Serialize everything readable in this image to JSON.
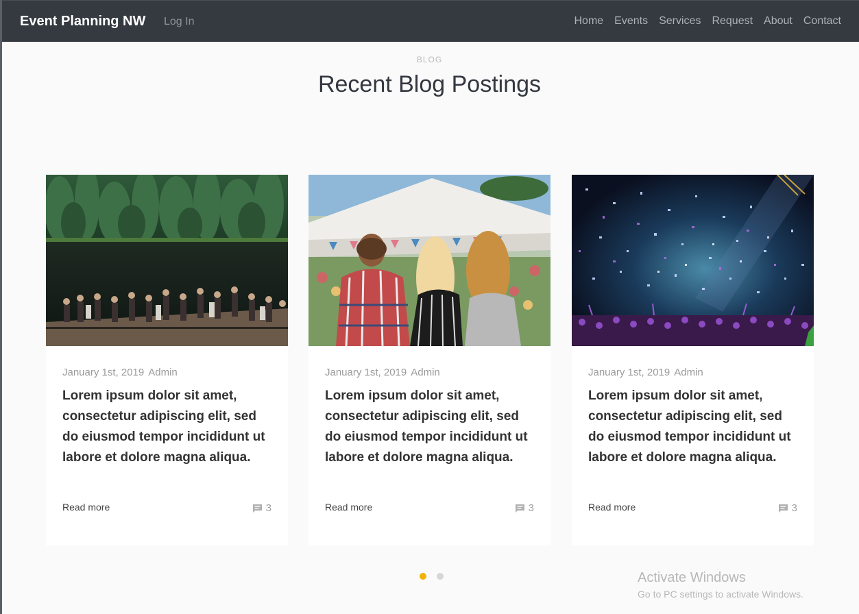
{
  "navbar": {
    "brand": "Event Planning NW",
    "login": "Log In",
    "links": [
      "Home",
      "Events",
      "Services",
      "Request",
      "About",
      "Contact"
    ]
  },
  "section": {
    "eyebrow": "BLOG",
    "title": "Recent Blog Postings"
  },
  "posts": [
    {
      "image": "lakeside-party-photo",
      "date": "January 1st, 2019",
      "author": "Admin",
      "headline": "Lorem ipsum dolor sit amet, consectetur adipiscing elit, sed do eiusmod tempor incididunt ut labore et dolore magna aliqua.",
      "read_more": "Read more",
      "comments": "3"
    },
    {
      "image": "festival-tent-crowd-photo",
      "date": "January 1st, 2019",
      "author": "Admin",
      "headline": "Lorem ipsum dolor sit amet, consectetur adipiscing elit, sed do eiusmod tempor incididunt ut labore et dolore magna aliqua.",
      "read_more": "Read more",
      "comments": "3"
    },
    {
      "image": "concert-confetti-photo",
      "date": "January 1st, 2019",
      "author": "Admin",
      "headline": "Lorem ipsum dolor sit amet, consectetur adipiscing elit, sed do eiusmod tempor incididunt ut labore et dolore magna aliqua.",
      "read_more": "Read more",
      "comments": "3"
    }
  ],
  "carousel": {
    "active_index": 0,
    "count": 2,
    "active_color": "#f2b300",
    "inactive_color": "#d6d6d6"
  },
  "watermark": {
    "line1": "Activate Windows",
    "line2": "Go to PC settings to activate Windows."
  },
  "icons": {
    "comment": "comment-icon"
  }
}
